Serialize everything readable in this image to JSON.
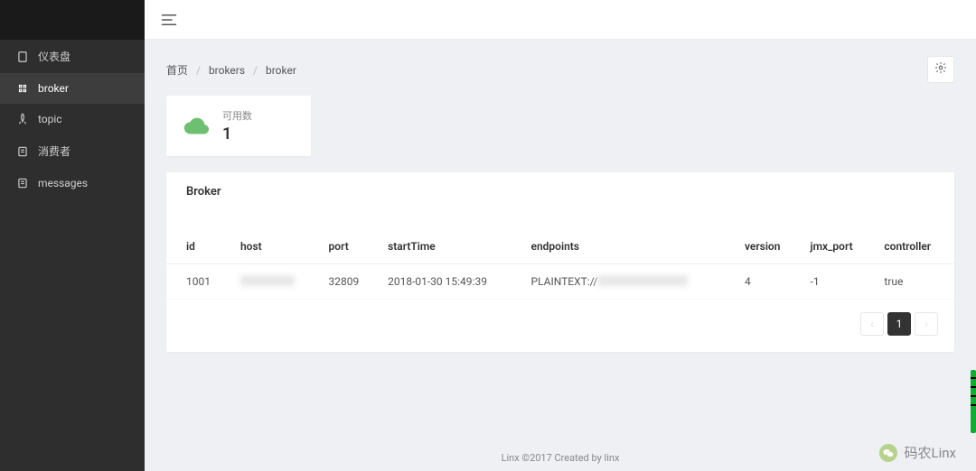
{
  "sidebar": {
    "items": [
      {
        "label": "仪表盘"
      },
      {
        "label": "broker"
      },
      {
        "label": "topic"
      },
      {
        "label": "消费者"
      },
      {
        "label": "messages"
      }
    ]
  },
  "breadcrumb": {
    "home": "首页",
    "l1": "brokers",
    "l2": "broker"
  },
  "stat": {
    "label": "可用数",
    "value": "1"
  },
  "panel": {
    "title": "Broker"
  },
  "table": {
    "headers": {
      "id": "id",
      "host": "host",
      "port": "port",
      "startTime": "startTime",
      "endpoints": "endpoints",
      "version": "version",
      "jmx_port": "jmx_port",
      "controller": "controller"
    },
    "rows": [
      {
        "id": "1001",
        "host": "",
        "port": "32809",
        "startTime": "2018-01-30 15:49:39",
        "endpoints_prefix": "PLAINTEXT://",
        "version": "4",
        "jmx_port": "-1",
        "controller": "true"
      }
    ]
  },
  "pagination": {
    "page": "1"
  },
  "footer": {
    "text": "Linx ©2017 Created by ",
    "link": "linx"
  },
  "watermark": {
    "text": "码农Linx"
  }
}
